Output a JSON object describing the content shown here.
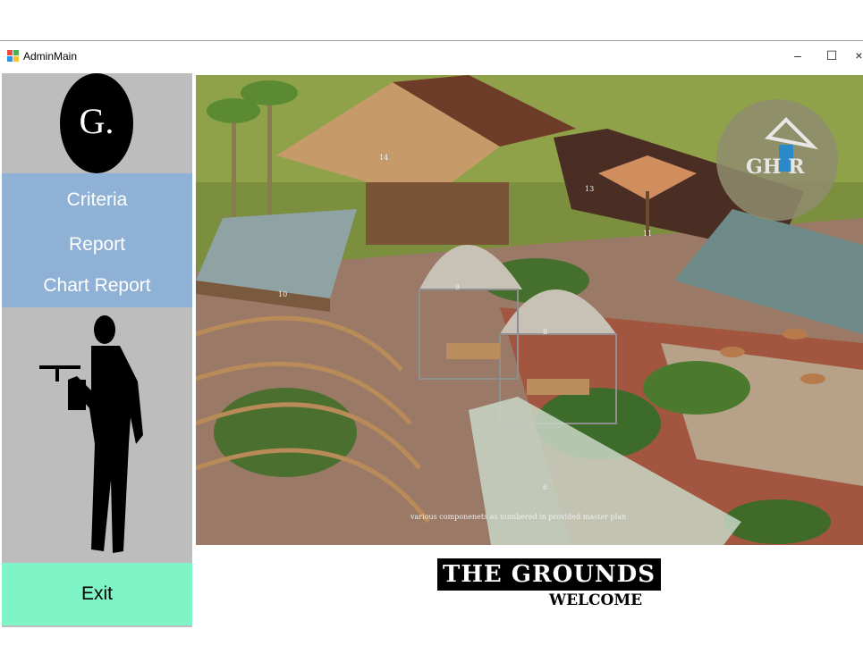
{
  "window": {
    "title": "AdminMain",
    "controls": {
      "minimize": "–",
      "maximize": "☐",
      "close": "×"
    }
  },
  "sidebar": {
    "logo_text": "G.",
    "menu": [
      {
        "label": "Criteria"
      },
      {
        "label": "Report"
      },
      {
        "label": "Chart Report"
      }
    ],
    "exit_label": "Exit",
    "colors": {
      "panel": "#bdbdbd",
      "menu": "#8fb1d6",
      "exit": "#7ff5c7"
    }
  },
  "scene": {
    "caption": "various componenets as numbered in provided master plan",
    "badge_text": "GH R",
    "plan_numbers": [
      "14",
      "13",
      "11",
      "10",
      "9",
      "8",
      "6"
    ]
  },
  "branding": {
    "title": "THE GROUNDS",
    "subtitle": "WELCOME"
  }
}
